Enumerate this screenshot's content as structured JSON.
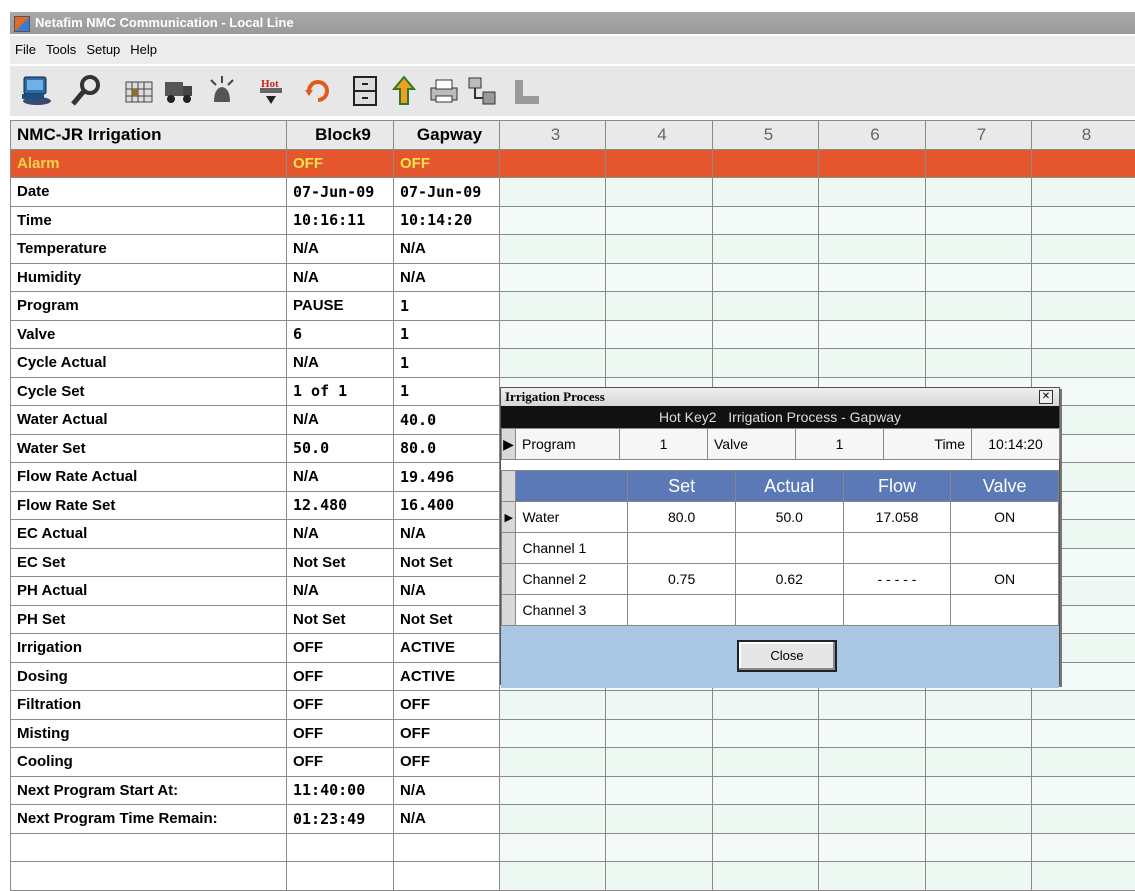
{
  "window": {
    "title": "Netafim NMC Communication - Local Line"
  },
  "menu": [
    "File",
    "Tools",
    "Setup",
    "Help"
  ],
  "toolbar": {
    "icons": [
      "computer-icon",
      "wrench-icon",
      "grid-icon",
      "truck-icon",
      "alarm-icon",
      "hot-key-icon",
      "refresh-icon",
      "cabinet-icon",
      "upload-arrow-icon",
      "printer-icon",
      "network-icon",
      "chart-icon"
    ],
    "hot_label": "Hot"
  },
  "grid": {
    "headers": [
      "NMC-JR Irrigation",
      "Block9",
      "Gapway",
      "3",
      "4",
      "5",
      "6",
      "7",
      "8"
    ],
    "rows": [
      {
        "label": "Alarm",
        "v1": "OFF",
        "v2": "OFF"
      },
      {
        "label": "Date",
        "v1": "07-Jun-09",
        "v2": "07-Jun-09"
      },
      {
        "label": "Time",
        "v1": "10:16:11",
        "v2": "10:14:20"
      },
      {
        "label": "Temperature",
        "v1": "N/A",
        "v2": "N/A"
      },
      {
        "label": "Humidity",
        "v1": "N/A",
        "v2": "N/A"
      },
      {
        "label": "Program",
        "v1": "PAUSE",
        "v2": "1"
      },
      {
        "label": "Valve",
        "v1": "6",
        "v2": "1"
      },
      {
        "label": "Cycle Actual",
        "v1": "N/A",
        "v2": "1"
      },
      {
        "label": "Cycle Set",
        "v1": "1 of 1",
        "v2": "1"
      },
      {
        "label": "Water Actual",
        "v1": "N/A",
        "v2": "40.0"
      },
      {
        "label": "Water Set",
        "v1": "50.0",
        "v2": "80.0"
      },
      {
        "label": "Flow Rate Actual",
        "v1": "N/A",
        "v2": "19.496"
      },
      {
        "label": "Flow Rate Set",
        "v1": "12.480",
        "v2": "16.400"
      },
      {
        "label": "EC Actual",
        "v1": "N/A",
        "v2": "N/A"
      },
      {
        "label": "EC Set",
        "v1": "Not Set",
        "v2": "Not Set"
      },
      {
        "label": "PH Actual",
        "v1": "N/A",
        "v2": "N/A"
      },
      {
        "label": "PH Set",
        "v1": "Not Set",
        "v2": "Not Set"
      },
      {
        "label": "Irrigation",
        "v1": "OFF",
        "v2": "ACTIVE"
      },
      {
        "label": "Dosing",
        "v1": "OFF",
        "v2": "ACTIVE"
      },
      {
        "label": "Filtration",
        "v1": "OFF",
        "v2": "OFF"
      },
      {
        "label": "Misting",
        "v1": "OFF",
        "v2": "OFF"
      },
      {
        "label": "Cooling",
        "v1": "OFF",
        "v2": "OFF"
      },
      {
        "label": "Next Program Start At:",
        "v1": "11:40:00",
        "v2": "N/A"
      },
      {
        "label": "Next Program Time Remain:",
        "v1": "01:23:49",
        "v2": "N/A"
      },
      {
        "label": "",
        "v1": "",
        "v2": ""
      },
      {
        "label": "",
        "v1": "",
        "v2": ""
      }
    ]
  },
  "dialog": {
    "title": "Irrigation Process",
    "caption_key": "Hot Key2",
    "caption_text": "Irrigation Process - Gapway",
    "program_label": "Program",
    "program_value": "1",
    "valve_label": "Valve",
    "valve_value": "1",
    "time_label": "Time",
    "time_value": "10:14:20",
    "columns": [
      "",
      "Set",
      "Actual",
      "Flow",
      "Valve"
    ],
    "rows": [
      {
        "name": "Water",
        "set": "80.0",
        "actual": "50.0",
        "flow": "17.058",
        "valve": "ON"
      },
      {
        "name": "Channel 1",
        "set": "",
        "actual": "",
        "flow": "",
        "valve": ""
      },
      {
        "name": "Channel 2",
        "set": "0.75",
        "actual": "0.62",
        "flow": "- - - - -",
        "valve": "ON"
      },
      {
        "name": "Channel 3",
        "set": "",
        "actual": "",
        "flow": "",
        "valve": ""
      }
    ],
    "close_label": "Close"
  },
  "colors": {
    "alarm_row": "#e4572e",
    "alarm_text": "#f6e34a",
    "dialog_header": "#5b79b7",
    "dialog_footer": "#a9c7e3"
  }
}
